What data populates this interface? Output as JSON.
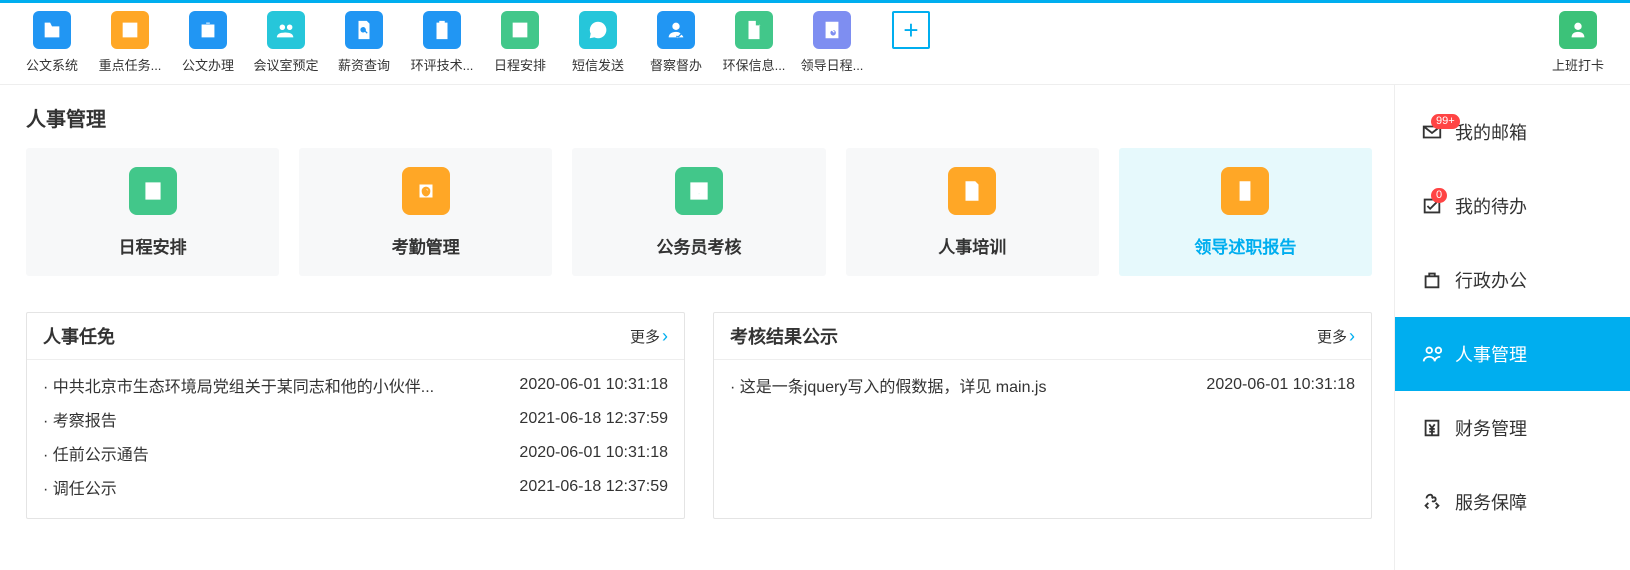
{
  "toolbar": {
    "items": [
      {
        "label": "公文系统",
        "color": "c-blue",
        "icon": "folder"
      },
      {
        "label": "重点任务...",
        "color": "c-orange",
        "icon": "chart"
      },
      {
        "label": "公文办理",
        "color": "c-blue",
        "icon": "briefcase"
      },
      {
        "label": "会议室预定",
        "color": "c-teal",
        "icon": "people"
      },
      {
        "label": "薪资查询",
        "color": "c-blue",
        "icon": "docsearch"
      },
      {
        "label": "环评技术...",
        "color": "c-blue",
        "icon": "clipboard"
      },
      {
        "label": "日程安排",
        "color": "c-green",
        "icon": "edit"
      },
      {
        "label": "短信发送",
        "color": "c-teal",
        "icon": "message"
      },
      {
        "label": "督察督办",
        "color": "c-blue",
        "icon": "usercheck"
      },
      {
        "label": "环保信息...",
        "color": "c-green",
        "icon": "file"
      },
      {
        "label": "领导日程...",
        "color": "c-purple",
        "icon": "searchdoc"
      }
    ],
    "clock_label": "上班打卡"
  },
  "page": {
    "title": "人事管理"
  },
  "cards": [
    {
      "label": "日程安排",
      "color": "c-green",
      "icon": "calendar",
      "active": false
    },
    {
      "label": "考勤管理",
      "color": "c-orange",
      "icon": "fingerprint",
      "active": false
    },
    {
      "label": "公务员考核",
      "color": "c-green",
      "icon": "assessment",
      "active": false
    },
    {
      "label": "人事培训",
      "color": "c-orange",
      "icon": "training",
      "active": false
    },
    {
      "label": "领导述职报告",
      "color": "c-orange",
      "icon": "report",
      "active": true
    }
  ],
  "panels": [
    {
      "title": "人事任免",
      "more": "更多",
      "rows": [
        {
          "text": "· 中共北京市生态环境局党组关于某同志和他的小伙伴...",
          "date": "2020-06-01 10:31:18"
        },
        {
          "text": "· 考察报告",
          "date": "2021-06-18 12:37:59"
        },
        {
          "text": "· 任前公示通告",
          "date": "2020-06-01 10:31:18"
        },
        {
          "text": "· 调任公示",
          "date": "2021-06-18 12:37:59"
        }
      ]
    },
    {
      "title": "考核结果公示",
      "more": "更多",
      "rows": [
        {
          "text": "· 这是一条jquery写入的假数据，详见 main.js",
          "date": "2020-06-01 10:31:18"
        }
      ]
    }
  ],
  "sidebar": [
    {
      "label": "我的邮箱",
      "icon": "mail",
      "badge": "99+",
      "active": false
    },
    {
      "label": "我的待办",
      "icon": "todo",
      "badge": "0",
      "active": false
    },
    {
      "label": "行政办公",
      "icon": "admin",
      "badge": null,
      "active": false
    },
    {
      "label": "人事管理",
      "icon": "hr",
      "badge": null,
      "active": true
    },
    {
      "label": "财务管理",
      "icon": "finance",
      "badge": null,
      "active": false
    },
    {
      "label": "服务保障",
      "icon": "service",
      "badge": null,
      "active": false
    }
  ]
}
